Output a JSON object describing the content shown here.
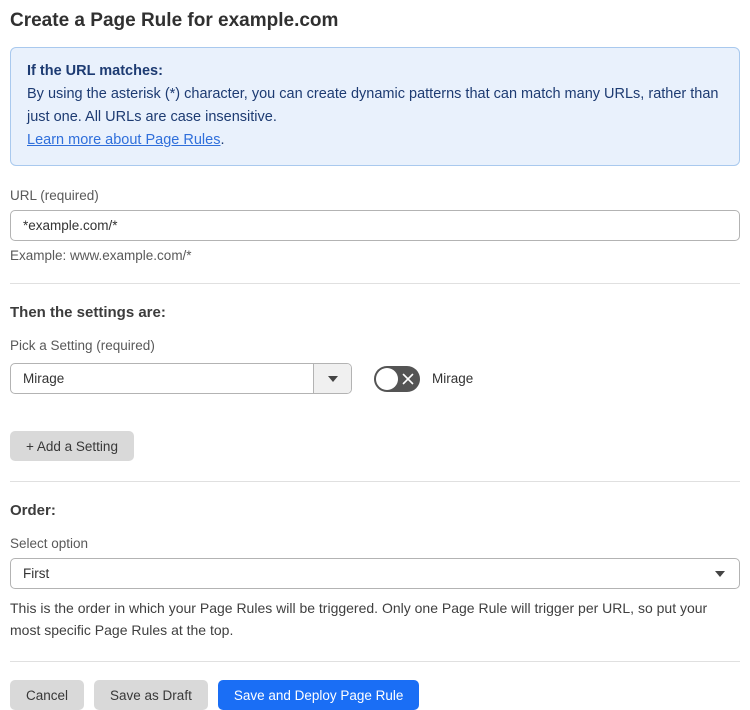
{
  "page": {
    "title": "Create a Page Rule for example.com"
  },
  "info_box": {
    "heading": "If the URL matches:",
    "body": "By using the asterisk (*) character, you can create dynamic patterns that can match many URLs, rather than just one. All URLs are case insensitive.",
    "link": "Learn more about Page Rules",
    "link_suffix": "."
  },
  "url_field": {
    "label": "URL (required)",
    "value": "*example.com/*",
    "example": "Example: www.example.com/*"
  },
  "settings": {
    "heading": "Then the settings are:",
    "pick_label": "Pick a Setting (required)",
    "selected_setting": "Mirage",
    "toggle_state": "off",
    "toggle_icon": "x-icon",
    "toggle_label": "Mirage",
    "add_button_label": "+ Add a Setting"
  },
  "order": {
    "heading": "Order:",
    "select_label": "Select option",
    "selected_option": "First",
    "help_text": "This is the order in which your Page Rules will be triggered. Only one Page Rule will trigger per URL, so put your most specific Page Rules at the top."
  },
  "footer": {
    "cancel_label": "Cancel",
    "save_draft_label": "Save as Draft",
    "save_deploy_label": "Save and Deploy Page Rule"
  },
  "colors": {
    "accent_blue": "#1a6ef5",
    "info_bg": "#e9f1fc",
    "info_border": "#a9c9ee",
    "info_text": "#1d3b72",
    "link_blue": "#2f6fdb",
    "toggle_off_bg": "#545454",
    "button_gray": "#d9d9d9"
  }
}
